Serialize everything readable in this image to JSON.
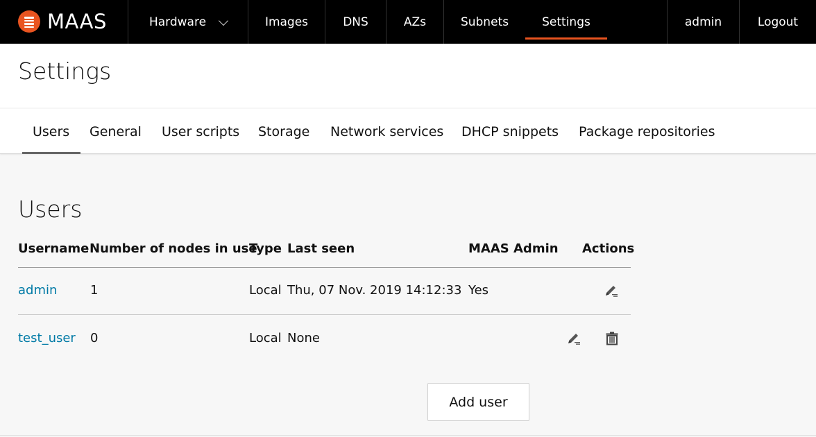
{
  "topnav": {
    "brand": "MAAS",
    "items": [
      {
        "label": "Hardware"
      },
      {
        "label": "Images"
      },
      {
        "label": "DNS"
      },
      {
        "label": "AZs"
      },
      {
        "label": "Subnets"
      },
      {
        "label": "Settings"
      }
    ],
    "user": "admin",
    "logout": "Logout",
    "accent_color": "#e95420"
  },
  "page": {
    "title": "Settings"
  },
  "tabs": [
    {
      "label": "Users"
    },
    {
      "label": "General"
    },
    {
      "label": "User scripts"
    },
    {
      "label": "Storage"
    },
    {
      "label": "Network services"
    },
    {
      "label": "DHCP snippets"
    },
    {
      "label": "Package repositories"
    }
  ],
  "users": {
    "title": "Users",
    "columns": [
      "Username",
      "Number of nodes in use",
      "Type",
      "Last seen",
      "MAAS Admin",
      "Actions"
    ],
    "rows": [
      {
        "username": "admin",
        "nodes": "1",
        "type": "Local",
        "last_seen": "Thu, 07 Nov. 2019 14:12:33",
        "admin": "Yes",
        "actions": [
          "edit-icon"
        ]
      },
      {
        "username": "test_user",
        "nodes": "0",
        "type": "Local",
        "last_seen": "None",
        "admin": "",
        "actions": [
          "edit-icon",
          "trash-icon"
        ]
      }
    ],
    "add_button": "Add user",
    "link_color": "#007aa6"
  }
}
